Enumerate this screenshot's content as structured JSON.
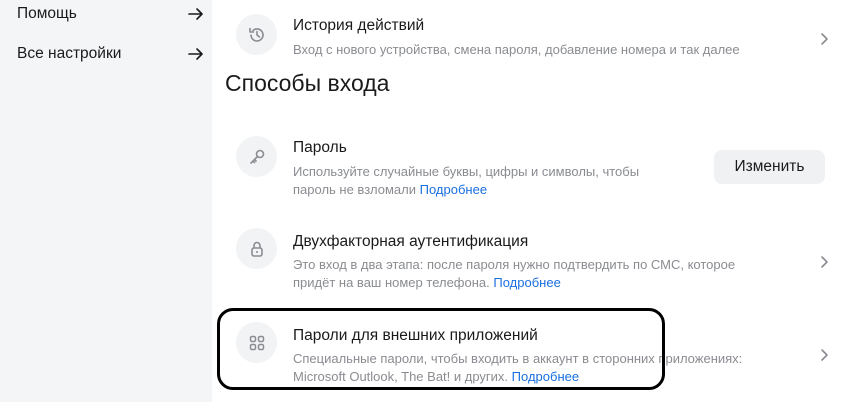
{
  "sidebar": {
    "items": [
      {
        "label": "Помощь",
        "icon": "arrow-right-icon"
      },
      {
        "label": "Все настройки",
        "icon": "arrow-right-icon"
      }
    ]
  },
  "history": {
    "title": "История действий",
    "desc": "Вход с нового устройства, смена пароля, добавление номера и так далее",
    "icon": "history-icon"
  },
  "section": {
    "title": "Способы входа"
  },
  "password": {
    "title": "Пароль",
    "desc_line1": "Используйте случайные буквы, цифры и символы, чтобы",
    "desc_line2": "пароль не взломали",
    "link": "Подробнее",
    "button": "Изменить",
    "icon": "key-icon"
  },
  "two_factor": {
    "title": "Двухфакторная аутентификация",
    "desc_line1": "Это вход в два этапа: после пароля нужно подтвердить по СМС, которое",
    "desc_line2": "придёт на ваш номер телефона.",
    "link": "Подробнее",
    "icon": "lock-icon"
  },
  "app_passwords": {
    "title": "Пароли для внешних приложений",
    "desc_line1": "Специальные пароли, чтобы входить в аккаунт в сторонних приложениях:",
    "desc_line2": "Microsoft Outlook, The Bat! и других.",
    "link": "Подробнее",
    "icon": "apps-grid-icon"
  },
  "colors": {
    "sidebar_bg": "#f4f5f7",
    "link": "#1a6fe0",
    "muted_text": "#8a8c91",
    "icon_bg": "#f2f3f5",
    "highlight_border": "#000000"
  }
}
